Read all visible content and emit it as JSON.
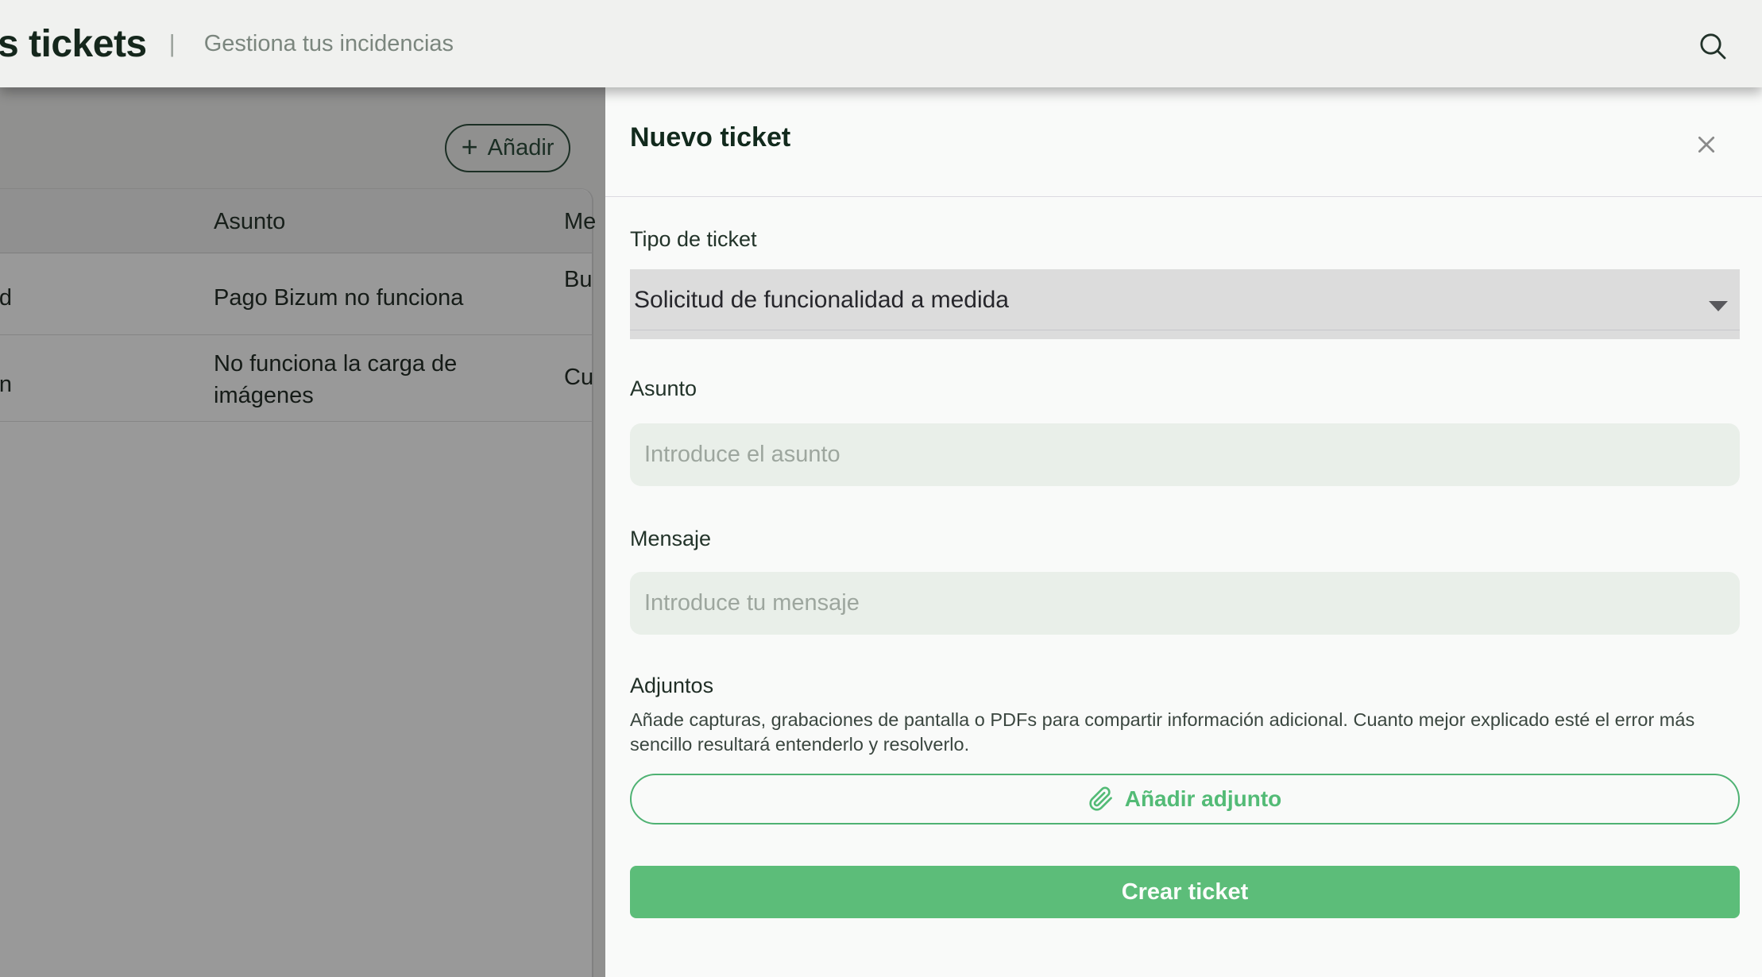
{
  "header": {
    "title_visible": "s tickets",
    "separator": "|",
    "subtitle": "Gestiona tus incidencias"
  },
  "list_page": {
    "add_button": {
      "plus": "+",
      "label": "Añadir"
    },
    "table": {
      "headers": {
        "col1_visible": "",
        "col2": "Asunto",
        "col3_visible": "Me"
      },
      "rows": [
        {
          "col1_visible": "d",
          "col2": "Pago Bizum no funciona",
          "col3_visible": "Bu"
        },
        {
          "col1_visible": "n",
          "col2": "No funciona la carga de imágenes",
          "col3_visible": "Cu"
        }
      ]
    }
  },
  "panel": {
    "title": "Nuevo ticket",
    "fields": {
      "type": {
        "label": "Tipo de ticket",
        "value": "Solicitud de funcionalidad a medida"
      },
      "subject": {
        "label": "Asunto",
        "placeholder": "Introduce el asunto",
        "value": ""
      },
      "message": {
        "label": "Mensaje",
        "placeholder": "Introduce tu mensaje",
        "value": ""
      }
    },
    "attachments": {
      "title": "Adjuntos",
      "description": "Añade capturas, grabaciones de pantalla o PDFs para compartir información adicional. Cuanto mejor explicado esté el error más sencillo resultará entenderlo y resolverlo.",
      "add_button_label": "Añadir adjunto"
    },
    "submit_label": "Crear ticket"
  },
  "icons": {
    "search": "magnifier-icon",
    "close": "x-icon",
    "caret": "chevron-down-icon",
    "paperclip": "paperclip-icon"
  },
  "colors": {
    "accent_green": "#5cbd79",
    "accent_green_border": "#4fb273",
    "dark_green_text": "#15271c",
    "header_bg": "#f0f1ef",
    "panel_bg": "#f9faf9",
    "select_bg": "#dcdcdc",
    "input_bg": "#e9efe9",
    "overlay": "rgba(0,0,0,0.40)"
  }
}
